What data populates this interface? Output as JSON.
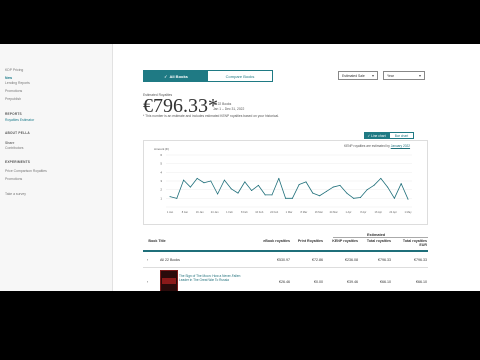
{
  "sidebar": {
    "top_item": "KDP Pricing",
    "group1": {
      "active": "New",
      "items": [
        "Lending Reports",
        "Promotions",
        "Prepublish"
      ]
    },
    "group2": {
      "heading": "REPORTS",
      "items": [
        "Royalties Estimator"
      ]
    },
    "group3": {
      "heading": "ABOUT PELLA",
      "items": [
        "Share",
        "Contributors"
      ]
    },
    "group4": {
      "heading": "EXPERIMENTS",
      "items": [
        "Price Comparison Royalties",
        "Promotions"
      ]
    },
    "footer": "Take a survey"
  },
  "tabs": {
    "all": "All Books",
    "compare": "Compare Books"
  },
  "selects": {
    "left": "Estimated Sale",
    "right": "Year"
  },
  "summary": {
    "caption": "Estimated Royalties",
    "amount": "€796.33*",
    "meta_line1": "All 22 Books",
    "meta_line2": "Jan 1 – Dec 31, 2022",
    "note": "* This number is an estimate and includes estimated KENP royalties based on your historical."
  },
  "chart_toggle": {
    "on": "Line chart",
    "off": "Bar chart"
  },
  "chart_note": {
    "text": "KENP royalties are estimated by",
    "link": "January 2022"
  },
  "chart_data": {
    "type": "line",
    "ylabel": "Amount (€)",
    "yticks": [
      "1",
      "2",
      "3",
      "4",
      "5",
      "6"
    ],
    "ylim": [
      0,
      6
    ],
    "x": [
      "1 Jan",
      "8 Jan",
      "16 Jan",
      "24 Jan",
      "1 Feb",
      "8 Feb",
      "16 Feb",
      "24 Feb",
      "1 Mar",
      "8 Mar",
      "16 Mar",
      "24 Mar",
      "1 Apr",
      "8 Apr",
      "16 Apr",
      "24 Apr",
      "1 May"
    ],
    "values": [
      1.2,
      1.0,
      3.1,
      2.3,
      3.3,
      2.8,
      3.0,
      1.5,
      3.1,
      2.1,
      1.6,
      2.9,
      1.9,
      2.5,
      1.4,
      1.4,
      3.3,
      1.0,
      1.0,
      2.6,
      2.9,
      1.6,
      1.3,
      1.8,
      2.3,
      2.5,
      1.6,
      1.0,
      1.1,
      2.0,
      2.5,
      3.3,
      2.3,
      1.0,
      2.7,
      0.9
    ],
    "x_labels_shown": [
      "1 Jan",
      "8 Jan",
      "16 Jan",
      "24 Jan",
      "1 Feb",
      "8 Feb",
      "16 Feb",
      "24 Feb",
      "1 Mar",
      "8 Mar",
      "16 Mar",
      "24 Mar",
      "1 Apr",
      "8 Apr",
      "16 Apr",
      "24 Apr",
      "1 May"
    ],
    "color": "#1f6f7a",
    "grid": true
  },
  "table": {
    "group_header": "Estimated",
    "columns": [
      "Book Title",
      "eBook royalties",
      "Print Royalties",
      "KENP royalties",
      "Total royalties",
      "Total royalties EUR"
    ],
    "rows": [
      {
        "title": "All 22 Books",
        "ebook": "€530.97",
        "print": "€72.86",
        "kenp": "€236.08",
        "total": "€796.33",
        "total_eur": "€796.33"
      },
      {
        "title": "The Sign of The Moon: How a Never-Fallen Leader in The Great War To Russia",
        "ebook": "€26.46",
        "print": "€0.00",
        "kenp": "€39.46",
        "total": "€66.10",
        "total_eur": "€66.10"
      }
    ]
  }
}
